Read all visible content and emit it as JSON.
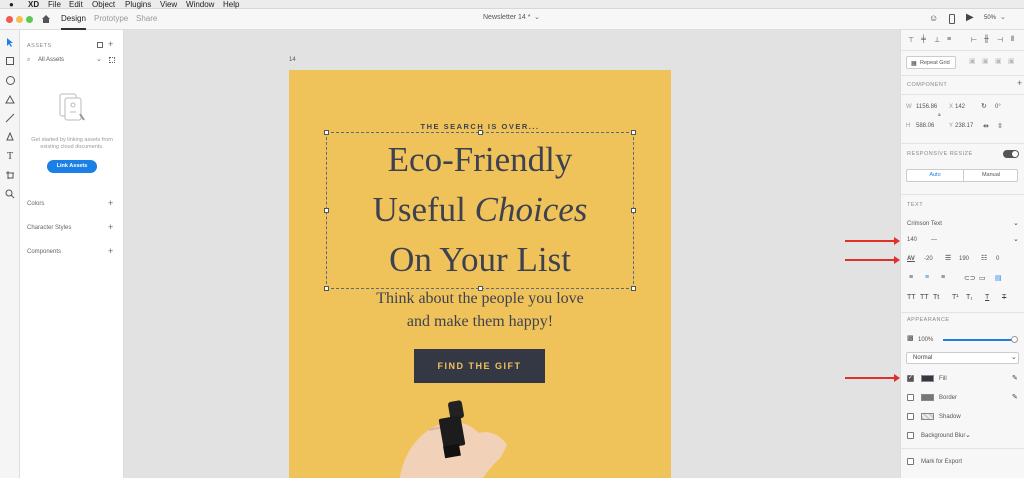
{
  "menubar": {
    "app": "XD",
    "items": [
      "File",
      "Edit",
      "Object",
      "Plugins",
      "View",
      "Window",
      "Help"
    ]
  },
  "appbar": {
    "tabs": [
      "Design",
      "Prototype",
      "Share"
    ],
    "doc_title": "Newsletter 14 *",
    "zoom": "50%"
  },
  "assets": {
    "title": "ASSETS",
    "filter": "All Assets",
    "empty_text": "Get started by linking assets from existing cloud documents.",
    "link_button": "Link Assets",
    "sections": [
      "Colors",
      "Character Styles",
      "Components"
    ]
  },
  "canvas": {
    "artboard_label": "14",
    "eyebrow": "THE SEARCH IS OVER...",
    "headline1": "Eco-Friendly",
    "headline2a": "Useful ",
    "headline2b": "Choices",
    "headline3": "On Your List",
    "body1": "Think about the people you love",
    "body2": "and make them happy!",
    "cta": "FIND THE GIFT"
  },
  "props": {
    "repeat_grid": "Repeat Grid",
    "component": "COMPONENT",
    "w_label": "W",
    "w": "1156.86",
    "x_label": "X",
    "x": "142",
    "rot": "0°",
    "h_label": "H",
    "h": "588.06",
    "y_label": "Y",
    "y": "238.17",
    "responsive": "RESPONSIVE RESIZE",
    "auto": "Auto",
    "manual": "Manual",
    "text_title": "TEXT",
    "font": "Crimson Text",
    "size": "140",
    "weight": "—",
    "tracking": "-20",
    "line_height": "190",
    "para": "0",
    "appearance": "APPEARANCE",
    "opacity": "100%",
    "blend": "Normal",
    "fill": "Fill",
    "border": "Border",
    "shadow": "Shadow",
    "bg_blur": "Background Blur",
    "export": "Mark for Export"
  },
  "colors": {
    "artboard": "#f0c35a",
    "text": "#3e4250",
    "button": "#343844",
    "accent": "#1a80e5",
    "arrow": "#e0302a"
  }
}
